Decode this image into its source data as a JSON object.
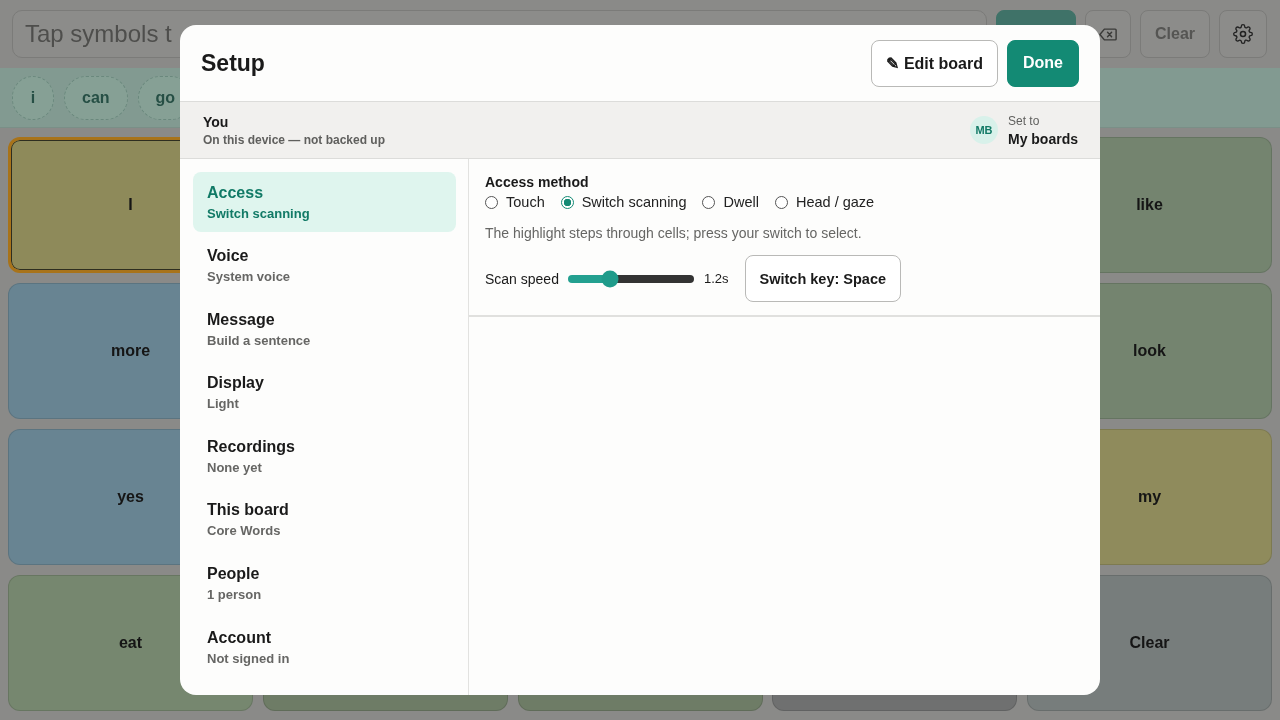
{
  "message_bar": {
    "placeholder": "Tap symbols t",
    "buttons": [
      {
        "kind": "primary"
      },
      {
        "kind": "backspace"
      },
      {
        "kind": "text",
        "label": "Clear"
      },
      {
        "kind": "settings"
      }
    ]
  },
  "sentence_strip": {
    "chips": [
      "i",
      "can",
      "go"
    ]
  },
  "board": {
    "rows": [
      {
        "cells": [
          {
            "label": "I",
            "color": "#8e8a5a",
            "highlighted": true
          },
          {
            "label": "like",
            "color": "#74846f",
            "highlighted": false
          }
        ]
      },
      {
        "cells": [
          {
            "label": "more",
            "color": "#688492",
            "highlighted": false
          },
          {
            "label": "look",
            "color": "#74846f",
            "highlighted": false
          }
        ]
      },
      {
        "cells": [
          {
            "label": "yes",
            "color": "#688492",
            "highlighted": false
          },
          {
            "label": "my",
            "color": "#8f8b5c",
            "highlighted": false
          }
        ]
      },
      {
        "cells": [
          {
            "label": "eat",
            "color": "#76876f",
            "highlighted": false
          },
          {
            "color": "#6e7c66",
            "highlighted": false
          },
          {
            "color": "#6e7c66",
            "highlighted": false
          },
          {
            "color": "#6f7070",
            "highlighted": false
          },
          {
            "label": "Clear",
            "color": "#777d7c",
            "highlighted": false
          }
        ]
      }
    ]
  },
  "dialog": {
    "title": "Setup",
    "actions": [
      {
        "kind": "secondary",
        "label": "✎ Edit board"
      },
      {
        "kind": "primary",
        "label": "Done"
      }
    ],
    "profile": {
      "name": "You",
      "detail": "On this device — not backed up",
      "avatar": "MB",
      "caption": "Set to",
      "value": "My boards"
    },
    "nav": [
      {
        "title": "Access",
        "subtitle": "Switch scanning",
        "selected": true
      },
      {
        "title": "Voice",
        "subtitle": "System voice",
        "selected": false
      },
      {
        "title": "Message",
        "subtitle": "Build a sentence",
        "selected": false
      },
      {
        "title": "Display",
        "subtitle": "Light",
        "selected": false
      },
      {
        "title": "Recordings",
        "subtitle": "None yet",
        "selected": false
      },
      {
        "title": "This board",
        "subtitle": "Core Words",
        "selected": false
      },
      {
        "title": "People",
        "subtitle": "1 person",
        "selected": false
      },
      {
        "title": "Account",
        "subtitle": "Not signed in",
        "selected": false
      }
    ],
    "access": {
      "heading": "Access method",
      "options": [
        {
          "label": "Touch",
          "selected": false
        },
        {
          "label": "Switch scanning",
          "selected": true
        },
        {
          "label": "Dwell",
          "selected": false
        },
        {
          "label": "Head / gaze",
          "selected": false
        }
      ],
      "hint": "The highlight steps through cells; press your switch to select.",
      "speed": {
        "label": "Scan speed",
        "level": 0.33,
        "reading": "1.2s"
      },
      "key_button": "Switch key: Space"
    }
  }
}
